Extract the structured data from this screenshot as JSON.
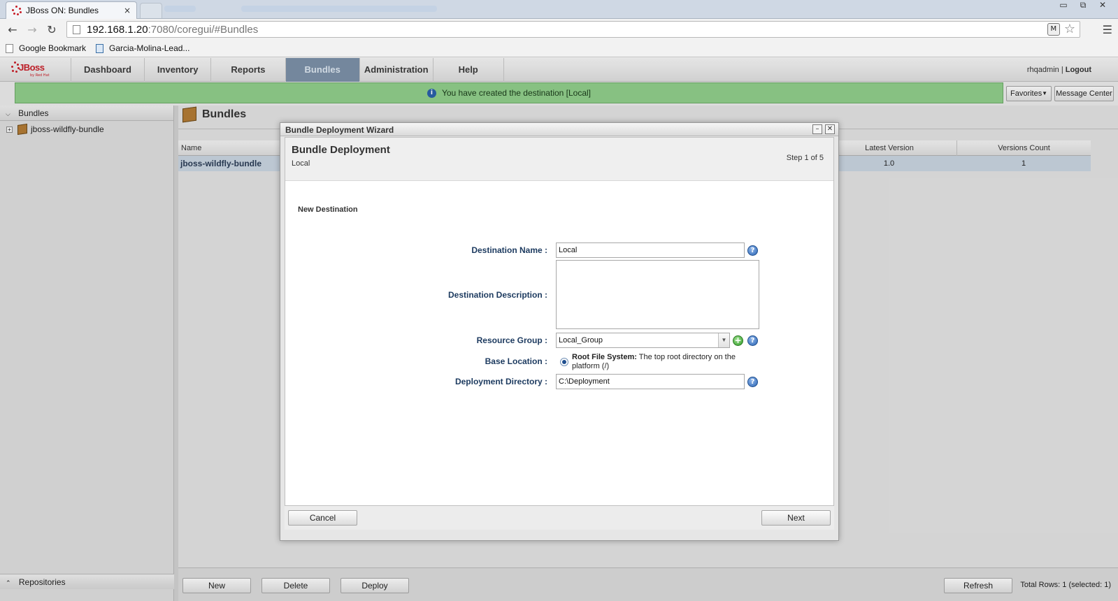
{
  "browser": {
    "tab_title": "JBoss ON: Bundles",
    "tab_close": "×",
    "url_host": "192.168.1.20",
    "url_rest": ":7080/coregui/#Bundles",
    "bookmarks": [
      "Google Bookmark",
      "Garcia-Molina-Lead..."
    ],
    "window_controls": [
      "▭",
      "⧉",
      "✕"
    ]
  },
  "app": {
    "logo_text": "JBoss",
    "logo_sub": "by Red Hat",
    "nav_tabs": [
      "Dashboard",
      "Inventory",
      "Reports",
      "Bundles",
      "Administration",
      "Help"
    ],
    "active_tab": "Bundles",
    "user": "rhqadmin",
    "separator": "|",
    "logout": "Logout",
    "message": "You have created the destination [Local]",
    "favorites_label": "Favorites",
    "message_center_label": "Message Center"
  },
  "left_panel": {
    "header": "Bundles",
    "tree_items": [
      "jboss-wildfly-bundle"
    ],
    "footer": "Repositories"
  },
  "main": {
    "title": "Bundles",
    "columns": [
      "Name",
      "Latest Version",
      "Versions Count"
    ],
    "rows": [
      {
        "name": "jboss-wildfly-bundle",
        "latest_version": "1.0",
        "versions_count": "1"
      }
    ],
    "buttons": {
      "new": "New",
      "delete": "Delete",
      "deploy": "Deploy",
      "refresh": "Refresh"
    },
    "totals": "Total Rows: 1 (selected: 1)"
  },
  "dialog": {
    "title": "Bundle Deployment Wizard",
    "header_title": "Bundle Deployment",
    "header_sub": "Local",
    "step": "Step 1 of 5",
    "section_title": "New Destination",
    "fields": {
      "destination_name_label": "Destination Name :",
      "destination_name_value": "Local",
      "destination_description_label": "Destination Description :",
      "destination_description_value": "",
      "resource_group_label": "Resource Group :",
      "resource_group_value": "Local_Group",
      "base_location_label": "Base Location :",
      "base_location_option_bold": "Root File System:",
      "base_location_option_text": " The top root directory on the platform (/)",
      "deployment_directory_label": "Deployment Directory :",
      "deployment_directory_value": "C:\\Deployment"
    },
    "cancel_label": "Cancel",
    "next_label": "Next"
  },
  "colors": {
    "message_bar": "#8fcc8a",
    "active_tab": "#7b8fa6",
    "label_text": "#1c3a5f",
    "selected_row": "#c7d2de"
  }
}
